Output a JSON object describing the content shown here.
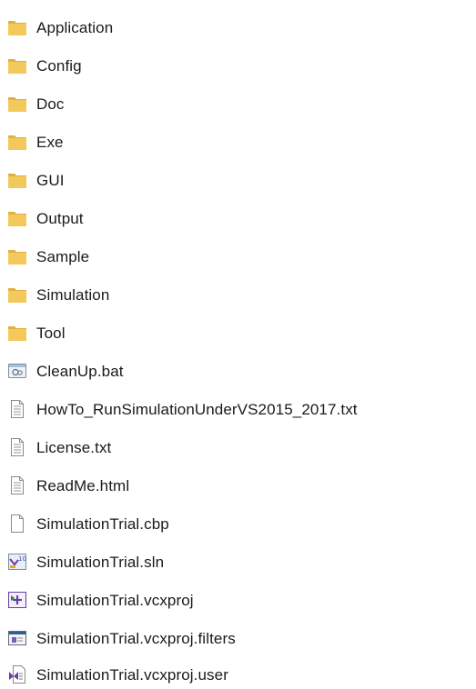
{
  "items": [
    {
      "name": "Application",
      "icon": "folder-icon"
    },
    {
      "name": "Config",
      "icon": "folder-icon"
    },
    {
      "name": "Doc",
      "icon": "folder-icon"
    },
    {
      "name": "Exe",
      "icon": "folder-icon"
    },
    {
      "name": "GUI",
      "icon": "folder-icon"
    },
    {
      "name": "Output",
      "icon": "folder-icon"
    },
    {
      "name": "Sample",
      "icon": "folder-icon"
    },
    {
      "name": "Simulation",
      "icon": "folder-icon"
    },
    {
      "name": "Tool",
      "icon": "folder-icon"
    },
    {
      "name": "CleanUp.bat",
      "icon": "batch-file-icon"
    },
    {
      "name": "HowTo_RunSimulationUnderVS2015_2017.txt",
      "icon": "text-file-icon"
    },
    {
      "name": "License.txt",
      "icon": "text-file-icon"
    },
    {
      "name": "ReadMe.html",
      "icon": "text-file-icon"
    },
    {
      "name": "SimulationTrial.cbp",
      "icon": "blank-file-icon"
    },
    {
      "name": "SimulationTrial.sln",
      "icon": "vs-solution-icon"
    },
    {
      "name": "SimulationTrial.vcxproj",
      "icon": "vcxproj-icon"
    },
    {
      "name": "SimulationTrial.vcxproj.filters",
      "icon": "filters-file-icon"
    },
    {
      "name": "SimulationTrial.vcxproj.user",
      "icon": "vs-user-file-icon"
    }
  ],
  "colors": {
    "folder": "#f4c95b",
    "folder_dark": "#e2b040",
    "text": "#1a1a1a"
  }
}
